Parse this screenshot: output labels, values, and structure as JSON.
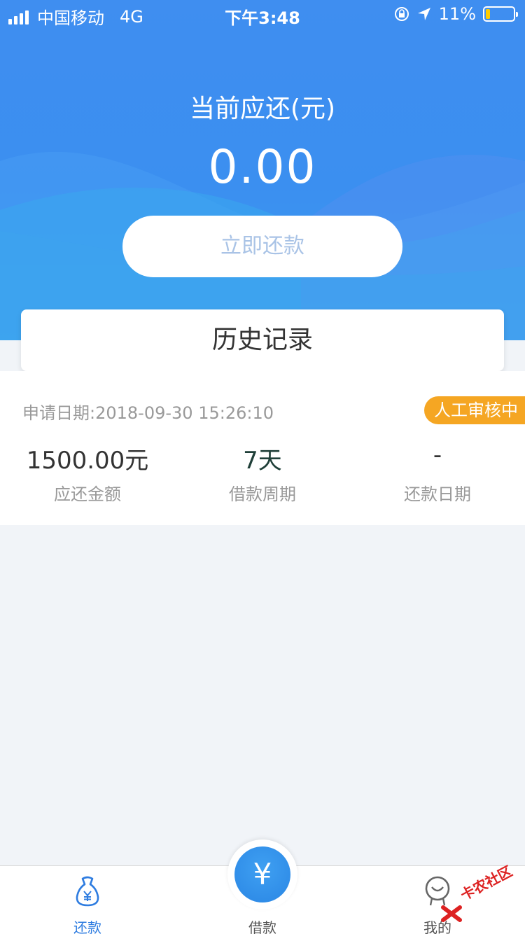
{
  "status_bar": {
    "carrier": "中国移动",
    "network": "4G",
    "time": "下午3:48",
    "battery": "11%"
  },
  "hero": {
    "title": "当前应还(元)",
    "amount": "0.00",
    "repay_button": "立即还款"
  },
  "history": {
    "title": "历史记录"
  },
  "record": {
    "date": "申请日期:2018-09-30 15:26:10",
    "status": "人工审核中",
    "stats": [
      {
        "value": "1500.00元",
        "label": "应还金额"
      },
      {
        "value": "7天",
        "label": "借款周期"
      },
      {
        "value": "-",
        "label": "还款日期"
      }
    ]
  },
  "tabbar": {
    "tabs": [
      {
        "label": "还款",
        "active": true
      },
      {
        "label": "借款",
        "active": false
      },
      {
        "label": "我的",
        "active": false
      }
    ],
    "center_symbol": "¥",
    "active_color": "#2e7ce0"
  },
  "watermark": "卡农社区",
  "colors": {
    "primary": "#3b8ff0",
    "badge": "#f5a623"
  }
}
